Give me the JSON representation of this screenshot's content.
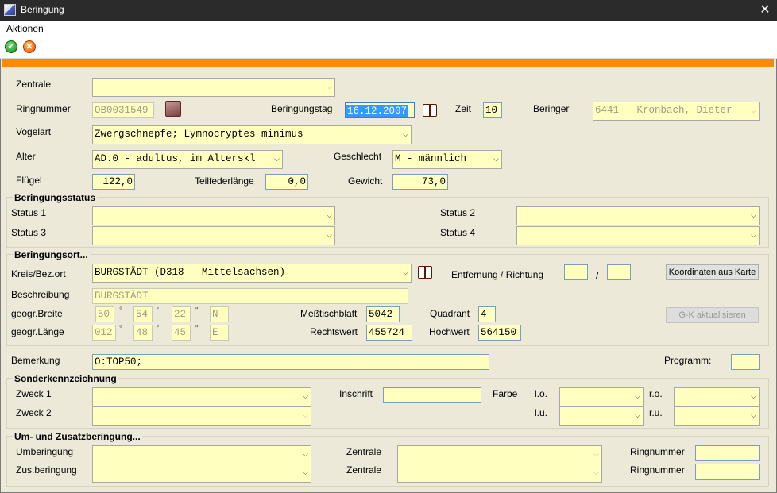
{
  "window": {
    "title": "Beringung",
    "close_glyph": "✕"
  },
  "menu": {
    "aktionen": "Aktionen"
  },
  "toolbar": {
    "ok_glyph": "✓",
    "cancel_glyph": "✕"
  },
  "colors": {
    "accent_bar": "#fa8a00",
    "field_bg": "#ffffc0",
    "panel_bg": "#ece9d8"
  },
  "labels": {
    "zentrale": "Zentrale",
    "ringnummer": "Ringnummer",
    "beringungstag": "Beringungstag",
    "zeit": "Zeit",
    "beringer": "Beringer",
    "vogelart": "Vogelart",
    "alter": "Alter",
    "geschlecht": "Geschlecht",
    "fluegel": "Flügel",
    "teilfederlaenge": "Teilfederlänge",
    "gewicht": "Gewicht",
    "status1": "Status 1",
    "status2": "Status 2",
    "status3": "Status 3",
    "status4": "Status 4",
    "kreis": "Kreis/Bez.ort",
    "entfernung": "Entfernung / Richtung",
    "slash": "/",
    "beschreibung": "Beschreibung",
    "breite": "geogr.Breite",
    "laenge": "geogr.Länge",
    "messtischblatt": "Meßtischblatt",
    "quadrant": "Quadrant",
    "rechtswert": "Rechtswert",
    "hochwert": "Hochwert",
    "bemerkung": "Bemerkung",
    "programm": "Programm:",
    "zweck1": "Zweck 1",
    "zweck2": "Zweck 2",
    "inschrift": "Inschrift",
    "farbe": "Farbe",
    "lo": "l.o.",
    "ro": "r.o.",
    "lu": "l.u.",
    "ru": "r.u.",
    "umberingung": "Umberingung",
    "zusberingung": "Zus.beringung",
    "zentrale_a": "Zentrale",
    "zentrale_b": "Zentrale",
    "ringnummer_a": "Ringnummer",
    "ringnummer_b": "Ringnummer",
    "deg": "°",
    "min": "'",
    "sec": "\""
  },
  "sections": {
    "status": "Beringungsstatus",
    "ort": "Beringungsort...",
    "sonder": "Sonderkennzeichnung",
    "umzusatz": "Um- und Zusatzberingung..."
  },
  "values": {
    "zentrale": "",
    "ringnummer": "OB0031549",
    "beringungstag": "16.12.2007",
    "zeit": "10",
    "beringer": "6441 - Kronbach, Dieter",
    "vogelart": "Zwergschnepfe;  Lymnocryptes minimus",
    "alter": "AD.0 - adultus, im Alterskl",
    "geschlecht": "M - männlich",
    "fluegel": "122,0",
    "teilfederlaenge": "0,0",
    "gewicht": "73,0",
    "status1": "",
    "status2": "",
    "status3": "",
    "status4": "",
    "kreis": "BURGSTÄDT (D318 - Mittelsachsen)",
    "entfernung": "",
    "richtung": "",
    "beschreibung": "BURGSTÄDT",
    "breite_deg": "50",
    "breite_min": "54",
    "breite_sec": "22",
    "breite_dir": "N",
    "laenge_deg": "012",
    "laenge_min": "48",
    "laenge_sec": "45",
    "laenge_dir": "E",
    "messtischblatt": "5042",
    "quadrant": "4",
    "rechtswert": "455724",
    "hochwert": "564150",
    "bemerkung": "O:TOP50;",
    "programm": "",
    "zweck1": "",
    "zweck2": "",
    "inschrift": "",
    "farbe_lo": "",
    "farbe_ro": "",
    "farbe_lu": "",
    "farbe_ru": "",
    "umberingung": "",
    "zusberingung": "",
    "um_zentrale": "",
    "zus_zentrale": "",
    "um_ringnummer": "",
    "zus_ringnummer": ""
  },
  "buttons": {
    "koordinaten": "Koordinaten aus Karte",
    "gk": "G-K aktualisieren"
  },
  "icons": {
    "combo_arrow": "⌵"
  }
}
